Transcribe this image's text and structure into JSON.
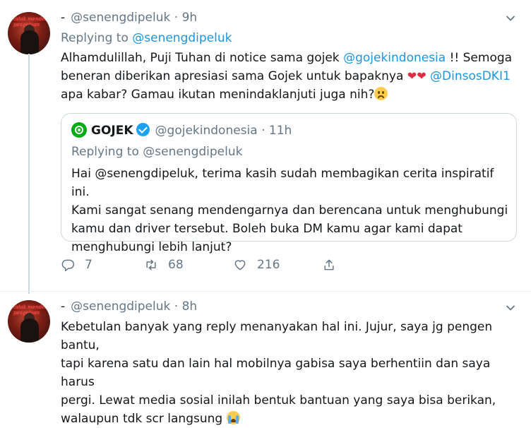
{
  "tweet1": {
    "author_dash": "-",
    "handle": "@senengdipeluk",
    "separator": "·",
    "time": "9h",
    "replying_prefix": "Replying to",
    "replying_handle": "@senengdipeluk",
    "line1_a": "Alhamdulillah, Puji Tuhan di notice sama gojek ",
    "line1_mention": "@gojekindonesia",
    "line1_b": " !! Semoga",
    "line2_a": "beneran diberikan apresiasi sama Gojek untuk bapaknya ",
    "line2_hearts": "❤❤",
    "line2_mention": "@DinsosDKI1",
    "line3_a": "apa kabar? Gamau ikutan menindaklanjuti juga nih?",
    "quote": {
      "name": "GOJEK",
      "handle": "@gojekindonesia",
      "separator": "·",
      "time": "11h",
      "replying_prefix": "Replying to",
      "replying_handle": "@senengdipeluk",
      "lines": [
        "Hai @senengdipeluk, terima kasih sudah membagikan cerita inspiratif ini.",
        "Kami sangat senang mendengarnya dan berencana untuk menghubungi",
        "kamu dan driver tersebut. Boleh buka DM kamu agar kami dapat",
        "menghubungi lebih lanjut?"
      ]
    },
    "actions": {
      "reply_count": "7",
      "retweet_count": "68",
      "like_count": "216"
    }
  },
  "tweet2": {
    "author_dash": "-",
    "handle": "@senengdipeluk",
    "separator": "·",
    "time": "8h",
    "lines": [
      "Kebetulan banyak yang reply menanyakan hal ini. Jujur, saya jg pengen bantu,",
      "tapi karena satu dan lain hal mobilnya gabisa saya berhentiin dan saya harus",
      "pergi. Lewat media sosial inilah bentuk bantuan yang saya bisa berikan,",
      "walaupun tdk scr langsung"
    ]
  },
  "avatar_sign": [
    "tidak mendek",
    "pengeluan"
  ],
  "icons": {
    "reply": "speech-bubble",
    "retweet": "retweet-arrows",
    "like": "heart-outline",
    "share": "share-upload",
    "caret": "chevron-down",
    "verified": "verified-badge",
    "gojek_logo": "gojek-logo"
  },
  "colors": {
    "link": "#1b95e0",
    "muted": "#657786",
    "text": "#14171a",
    "border": "#ccd6dd",
    "verified": "#1da1f2",
    "gojek": "#00aa13",
    "heart": "#dd2e44"
  }
}
